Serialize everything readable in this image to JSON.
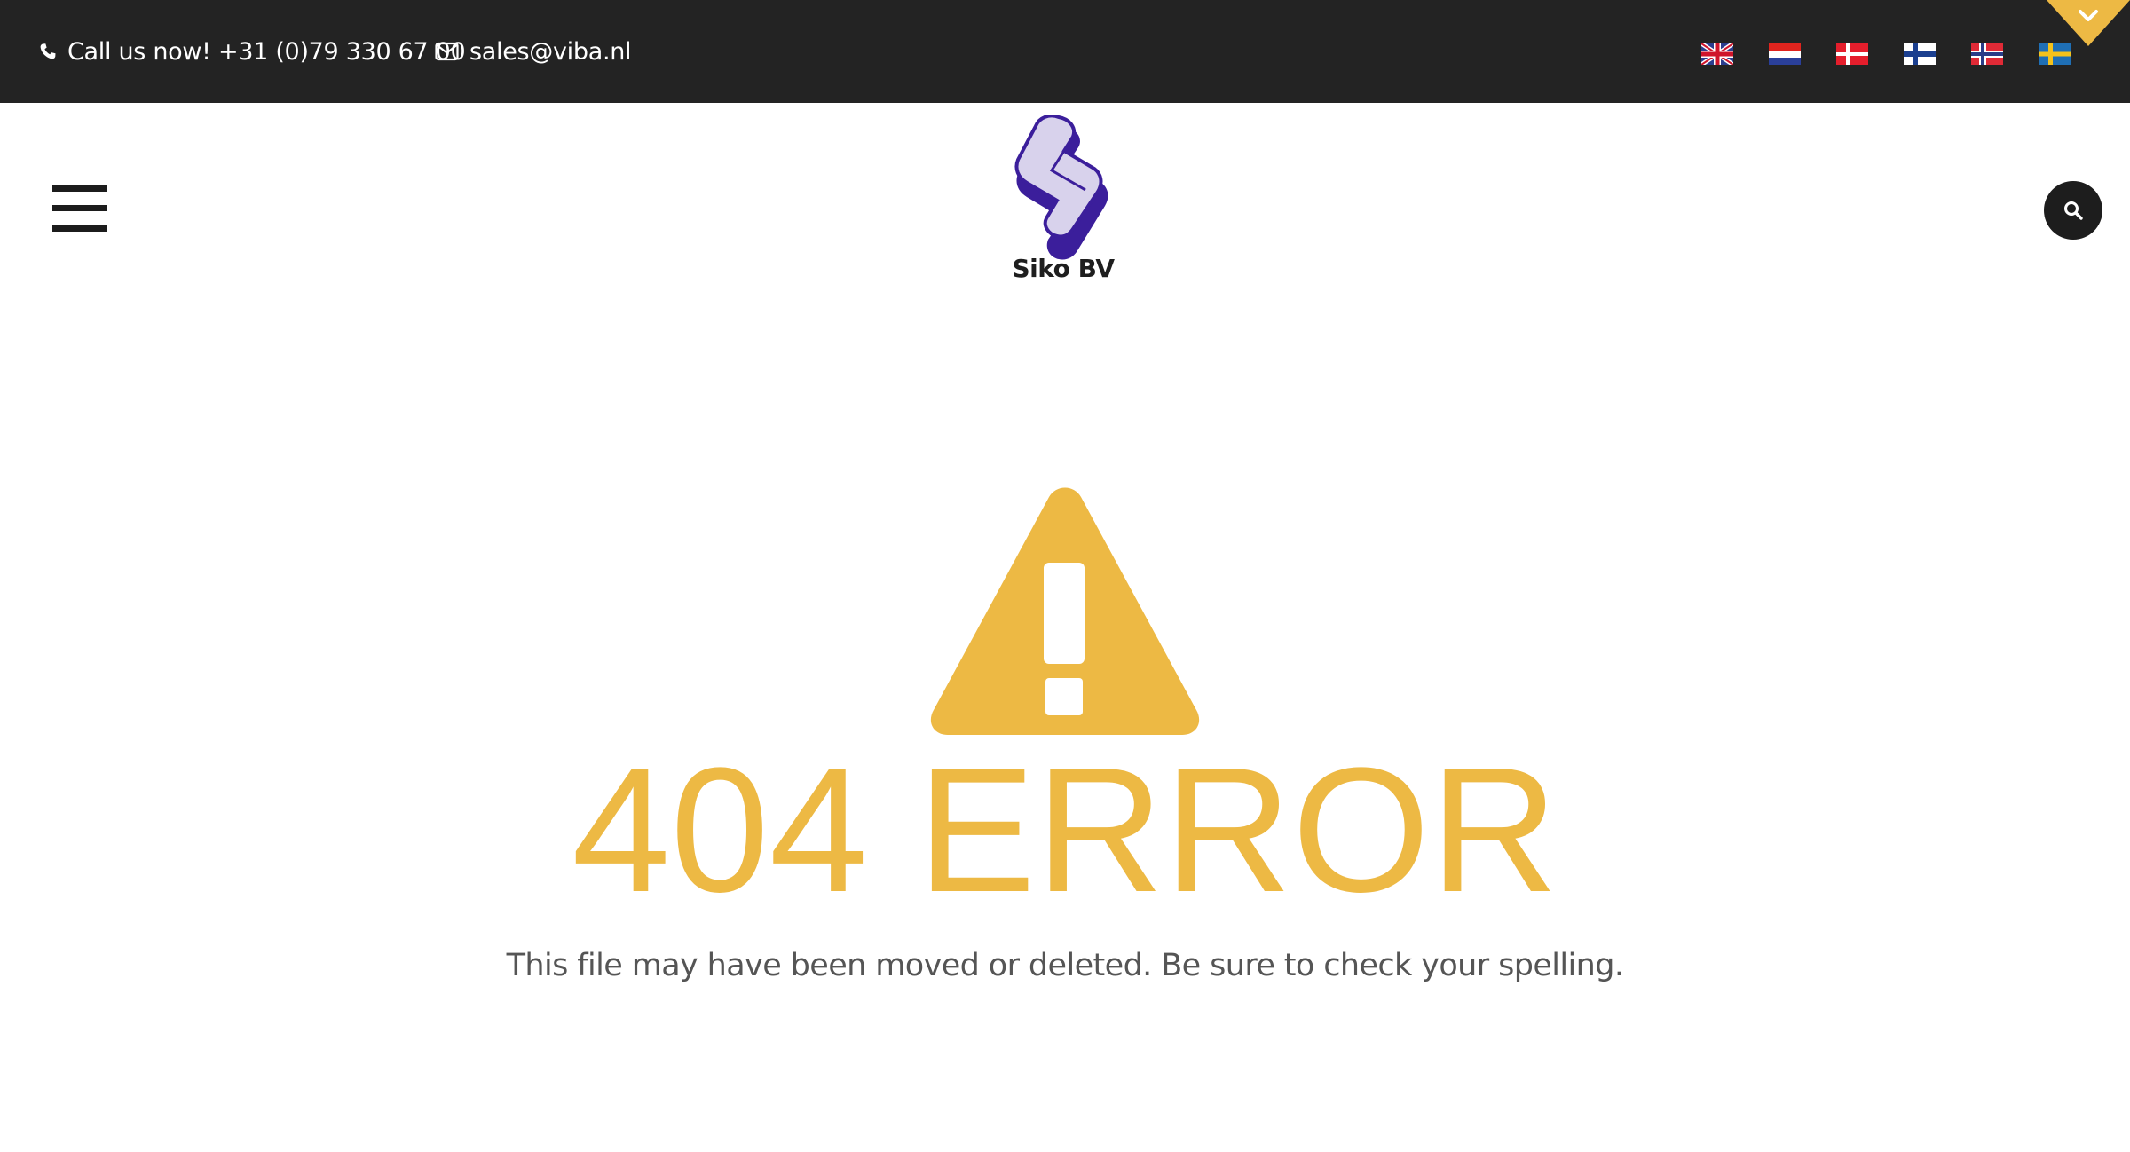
{
  "topbar": {
    "phone_icon": "phone-icon",
    "phone_text": "Call us now! +31 (0)79 330 67 00",
    "email_icon": "envelope-icon",
    "email_text": "sales@viba.nl",
    "languages": [
      "English",
      "Nederlands",
      "Dansk",
      "Suomi",
      "Norsk",
      "Svenska"
    ],
    "corner_icon": "chevron-down-icon"
  },
  "header": {
    "menu_icon": "hamburger-menu-icon",
    "logo_text": "Siko BV",
    "search_icon": "search-icon"
  },
  "error": {
    "icon": "warning-triangle-icon",
    "title": "404 ERROR",
    "message": "This file may have been moved or deleted. Be sure to check your spelling."
  },
  "colors": {
    "topbar_bg": "#232323",
    "accent": "#edb944",
    "logo_purple": "#3b1e9b",
    "logo_lavender": "#d8d2ec",
    "text_gray": "#555555"
  }
}
